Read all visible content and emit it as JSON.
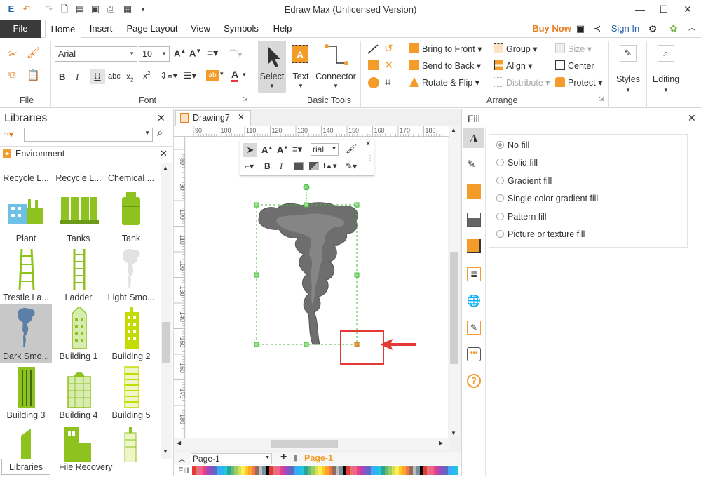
{
  "window": {
    "title": "Edraw Max (Unlicensed Version)",
    "controls": [
      "—",
      "☐",
      "✕"
    ]
  },
  "tabs": {
    "file": "File",
    "items": [
      "Home",
      "Insert",
      "Page Layout",
      "View",
      "Symbols",
      "Help"
    ],
    "active": "Home",
    "buy_now": "Buy Now",
    "sign_in": "Sign In"
  },
  "ribbon": {
    "font_name": "Arial",
    "font_size": "10",
    "groups": {
      "file": "File",
      "font": "Font",
      "basic_tools": "Basic Tools",
      "arrange": "Arrange"
    },
    "tools": {
      "select": "Select",
      "text": "Text",
      "connector": "Connector"
    },
    "arrange": {
      "bring_to_front": "Bring to Front",
      "send_to_back": "Send to Back",
      "rotate_flip": "Rotate & Flip",
      "group": "Group",
      "align": "Align",
      "distribute": "Distribute",
      "size": "Size",
      "center": "Center",
      "protect": "Protect"
    },
    "styles": "Styles",
    "editing": "Editing"
  },
  "libraries": {
    "title": "Libraries",
    "category": "Environment",
    "items": [
      {
        "label": "Recycle L..."
      },
      {
        "label": "Recycle L..."
      },
      {
        "label": "Chemical ..."
      },
      {
        "label": "Plant"
      },
      {
        "label": "Tanks"
      },
      {
        "label": "Tank"
      },
      {
        "label": "Trestle La..."
      },
      {
        "label": "Ladder"
      },
      {
        "label": "Light Smo..."
      },
      {
        "label": "Dark Smo..."
      },
      {
        "label": "Building 1"
      },
      {
        "label": "Building 2"
      },
      {
        "label": "Building 3"
      },
      {
        "label": "Building 4"
      },
      {
        "label": "Building 5"
      }
    ],
    "bottom_tabs": [
      "Libraries",
      "File Recovery"
    ]
  },
  "document": {
    "tab_name": "Drawing7",
    "ruler_h": [
      "90",
      "100",
      "110",
      "120",
      "130",
      "140",
      "150",
      "160",
      "170",
      "180"
    ],
    "ruler_v": [
      "80",
      "90",
      "100",
      "110",
      "120",
      "130",
      "140",
      "150",
      "160",
      "170",
      "180",
      "190"
    ],
    "mini_toolbar_font": "rial",
    "page_tabs": [
      "Page-1",
      "Page-1"
    ],
    "fill_label": "Fill"
  },
  "fill_panel": {
    "title": "Fill",
    "options": [
      "No fill",
      "Solid fill",
      "Gradient fill",
      "Single color gradient fill",
      "Pattern fill",
      "Picture or texture fill"
    ],
    "selected": "No fill"
  },
  "colors": {
    "accent_orange": "#f39c2a",
    "library_green": "#8dc21f",
    "highlight_red": "#e53935",
    "selection_green": "#45b83b"
  }
}
